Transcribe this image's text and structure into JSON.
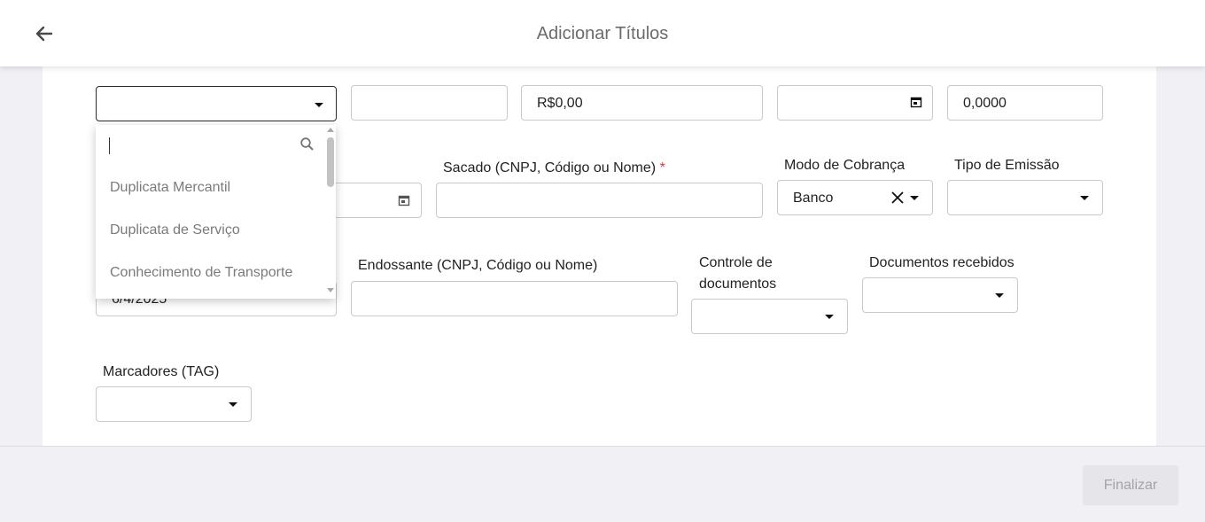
{
  "header": {
    "title": "Adicionar Títulos",
    "back_icon": "arrow-left-icon"
  },
  "row1": {
    "valor": "R$0,00",
    "taxa": "0,0000"
  },
  "row2": {
    "sacado_label": "Sacado (CNPJ, Código ou Nome)",
    "required_mark": "*",
    "modo_cobranca_label": "Modo de Cobrança",
    "modo_cobranca_value": "Banco",
    "tipo_emissao_label": "Tipo de Emissão"
  },
  "row3": {
    "date_partial": "6/4/2025",
    "endossante_label": "Endossante (CNPJ, Código ou Nome)",
    "controle_label_line1": "Controle de",
    "controle_label_line2": "documentos",
    "documentos_recebidos_label": "Documentos recebidos"
  },
  "row4": {
    "marcadores_label": "Marcadores (TAG)"
  },
  "dropdown": {
    "search_value": "",
    "items": [
      "Duplicata Mercantil",
      "Duplicata de Serviço",
      "Conhecimento de Transporte"
    ]
  },
  "footer": {
    "finalizar_label": "Finalizar"
  },
  "colors": {
    "required": "#d9363e",
    "header_title": "#6b6b6b",
    "footer_bg": "#f0f0f5",
    "disabled_button_bg": "#e6e6ea"
  }
}
